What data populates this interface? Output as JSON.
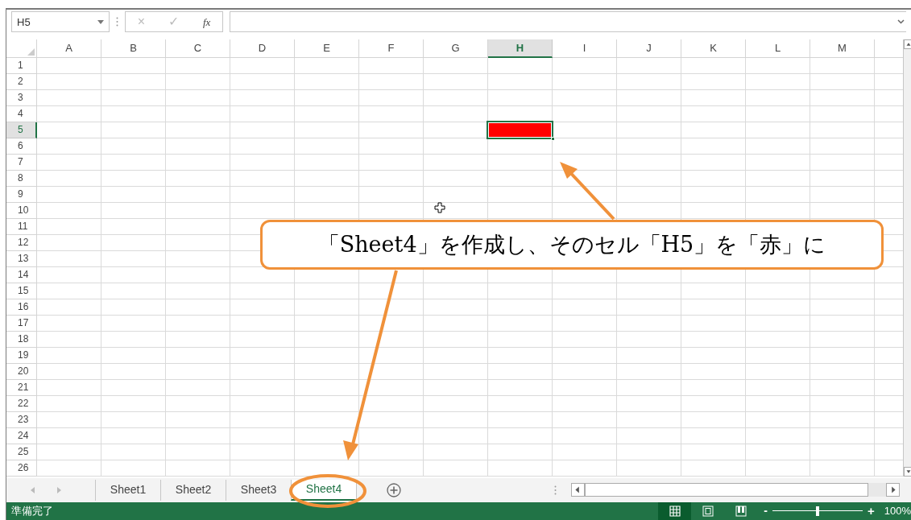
{
  "name_box": {
    "value": "H5"
  },
  "formula_bar": {
    "cancel": "×",
    "enter": "✓",
    "function": "fx"
  },
  "columns": [
    {
      "label": "A",
      "selected": false
    },
    {
      "label": "B",
      "selected": false
    },
    {
      "label": "C",
      "selected": false
    },
    {
      "label": "D",
      "selected": false
    },
    {
      "label": "E",
      "selected": false
    },
    {
      "label": "F",
      "selected": false
    },
    {
      "label": "G",
      "selected": false
    },
    {
      "label": "H",
      "selected": true
    },
    {
      "label": "I",
      "selected": false
    },
    {
      "label": "J",
      "selected": false
    },
    {
      "label": "K",
      "selected": false
    },
    {
      "label": "L",
      "selected": false
    },
    {
      "label": "M",
      "selected": false
    }
  ],
  "rows": [
    {
      "label": "1",
      "selected": false
    },
    {
      "label": "2",
      "selected": false
    },
    {
      "label": "3",
      "selected": false
    },
    {
      "label": "4",
      "selected": false
    },
    {
      "label": "5",
      "selected": true
    },
    {
      "label": "6",
      "selected": false
    },
    {
      "label": "7",
      "selected": false
    },
    {
      "label": "8",
      "selected": false
    },
    {
      "label": "9",
      "selected": false
    },
    {
      "label": "10",
      "selected": false
    },
    {
      "label": "11",
      "selected": false
    },
    {
      "label": "12",
      "selected": false
    },
    {
      "label": "13",
      "selected": false
    },
    {
      "label": "14",
      "selected": false
    },
    {
      "label": "15",
      "selected": false
    },
    {
      "label": "16",
      "selected": false
    },
    {
      "label": "17",
      "selected": false
    },
    {
      "label": "18",
      "selected": false
    },
    {
      "label": "19",
      "selected": false
    },
    {
      "label": "20",
      "selected": false
    },
    {
      "label": "21",
      "selected": false
    },
    {
      "label": "22",
      "selected": false
    },
    {
      "label": "23",
      "selected": false
    },
    {
      "label": "24",
      "selected": false
    },
    {
      "label": "25",
      "selected": false
    },
    {
      "label": "26",
      "selected": false
    }
  ],
  "active_cell": {
    "color": "#ff0000"
  },
  "sheet_tabs": [
    {
      "label": "Sheet1",
      "selected": false
    },
    {
      "label": "Sheet2",
      "selected": false
    },
    {
      "label": "Sheet3",
      "selected": false
    },
    {
      "label": "Sheet4",
      "selected": true
    }
  ],
  "status_bar": {
    "status": "準備完了",
    "views": [
      {
        "kind": "normal",
        "selected": true
      },
      {
        "kind": "page_layout",
        "selected": false
      },
      {
        "kind": "page_break",
        "selected": false
      }
    ],
    "zoom": {
      "minus": "-",
      "plus": "+",
      "level": 0.5,
      "reading": "100%"
    }
  },
  "callout": {
    "text": "「Sheet4」を作成し、そのセル「H5」を「赤」に"
  }
}
